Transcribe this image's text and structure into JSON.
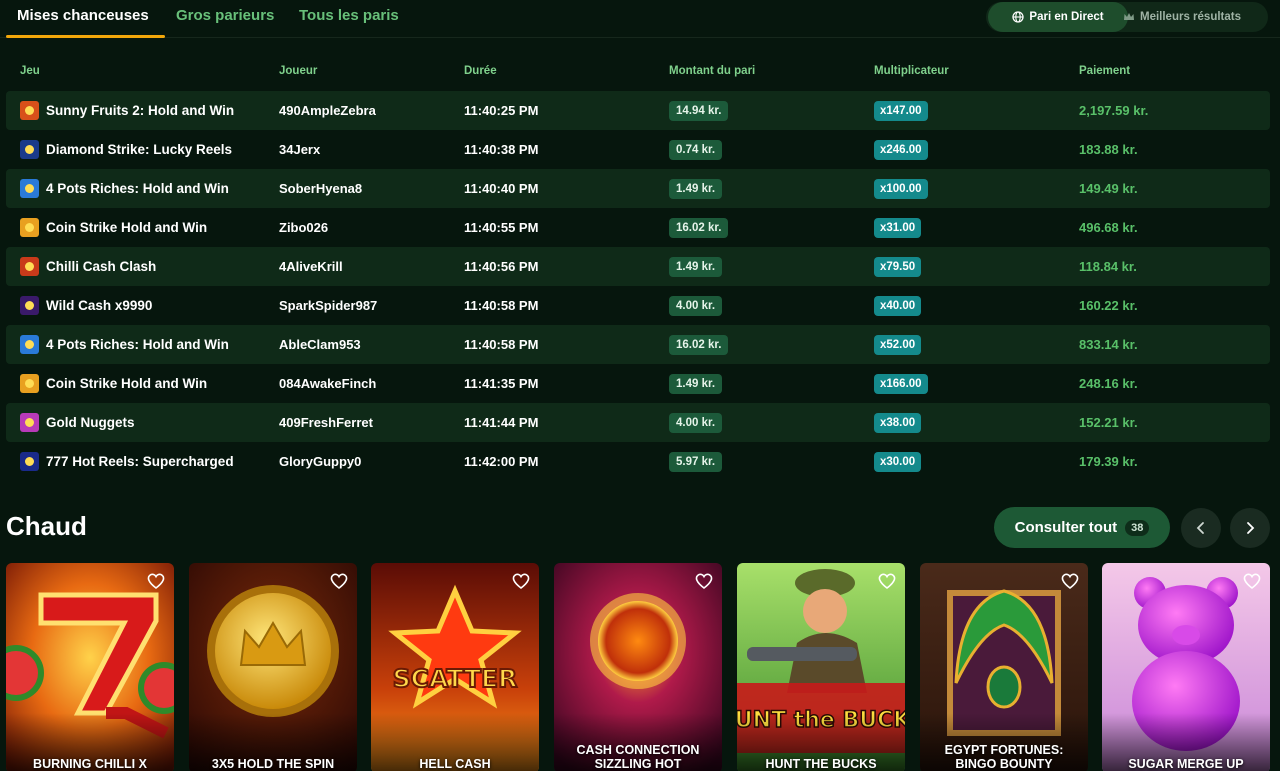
{
  "tabs": [
    {
      "label": "Mises chanceuses",
      "active": true
    },
    {
      "label": "Gros parieurs",
      "active": false
    },
    {
      "label": "Tous les paris",
      "active": false
    }
  ],
  "toggle": {
    "live_label": "Pari en Direct",
    "best_label": "Meilleurs résultats"
  },
  "table": {
    "headers": [
      "Jeu",
      "Joueur",
      "Durée",
      "Montant du pari",
      "Multiplicateur",
      "Paiement"
    ],
    "rows": [
      {
        "game": "Sunny Fruits 2: Hold and Win",
        "player": "490AmpleZebra",
        "time": "11:40:25 PM",
        "bet": "14.94 kr.",
        "multiplier": "x147.00",
        "payout": "2,197.59 kr.",
        "icon": "fruit-game-icon"
      },
      {
        "game": "Diamond Strike: Lucky Reels",
        "player": "34Jerx",
        "time": "11:40:38 PM",
        "bet": "0.74 kr.",
        "multiplier": "x246.00",
        "payout": "183.88 kr.",
        "icon": "diamond-game-icon"
      },
      {
        "game": "4 Pots Riches: Hold and Win",
        "player": "SoberHyena8",
        "time": "11:40:40 PM",
        "bet": "1.49 kr.",
        "multiplier": "x100.00",
        "payout": "149.49 kr.",
        "icon": "pots-game-icon"
      },
      {
        "game": "Coin Strike Hold and Win",
        "player": "Zibo026",
        "time": "11:40:55 PM",
        "bet": "16.02 kr.",
        "multiplier": "x31.00",
        "payout": "496.68 kr.",
        "icon": "coin-game-icon"
      },
      {
        "game": "Chilli Cash Clash",
        "player": "4AliveKrill",
        "time": "11:40:56 PM",
        "bet": "1.49 kr.",
        "multiplier": "x79.50",
        "payout": "118.84 kr.",
        "icon": "chilli-game-icon"
      },
      {
        "game": "Wild Cash x9990",
        "player": "SparkSpider987",
        "time": "11:40:58 PM",
        "bet": "4.00 kr.",
        "multiplier": "x40.00",
        "payout": "160.22 kr.",
        "icon": "wild-cash-game-icon"
      },
      {
        "game": "4 Pots Riches: Hold and Win",
        "player": "AbleClam953",
        "time": "11:40:58 PM",
        "bet": "16.02 kr.",
        "multiplier": "x52.00",
        "payout": "833.14 kr.",
        "icon": "pots-game-icon"
      },
      {
        "game": "Coin Strike Hold and Win",
        "player": "084AwakeFinch",
        "time": "11:41:35 PM",
        "bet": "1.49 kr.",
        "multiplier": "x166.00",
        "payout": "248.16 kr.",
        "icon": "coin-game-icon"
      },
      {
        "game": "Gold Nuggets",
        "player": "409FreshFerret",
        "time": "11:41:44 PM",
        "bet": "4.00 kr.",
        "multiplier": "x38.00",
        "payout": "152.21 kr.",
        "icon": "gold-nuggets-game-icon"
      },
      {
        "game": "777 Hot Reels: Supercharged",
        "player": "GloryGuppy0",
        "time": "11:42:00 PM",
        "bet": "5.97 kr.",
        "multiplier": "x30.00",
        "payout": "179.39 kr.",
        "icon": "hot-reels-game-icon"
      }
    ]
  },
  "hot": {
    "title": "Chaud",
    "see_all_label": "Consulter tout",
    "count": "38",
    "games": [
      {
        "title": "BURNING CHILLI X",
        "icon": "seven-icon"
      },
      {
        "title": "3X5 HOLD THE SPIN",
        "icon": "crown-coin-icon"
      },
      {
        "title": "HELL CASH",
        "icon": "scatter-star-icon",
        "art_text": "SCATTER"
      },
      {
        "title": "CASH CONNECTION SIZZLING HOT",
        "icon": "sun-icon"
      },
      {
        "title": "HUNT THE BUCKS",
        "icon": "hunter-icon",
        "art_text": "HUNT the BUCK$"
      },
      {
        "title": "EGYPT FORTUNES: BINGO BOUNTY",
        "icon": "scarab-icon"
      },
      {
        "title": "SUGAR MERGE UP",
        "icon": "gummy-bear-icon"
      }
    ]
  },
  "colors": {
    "background": "#06160d",
    "accent": "#f2a70a",
    "green_text": "#59c069",
    "multiplier": "#148a8c"
  }
}
